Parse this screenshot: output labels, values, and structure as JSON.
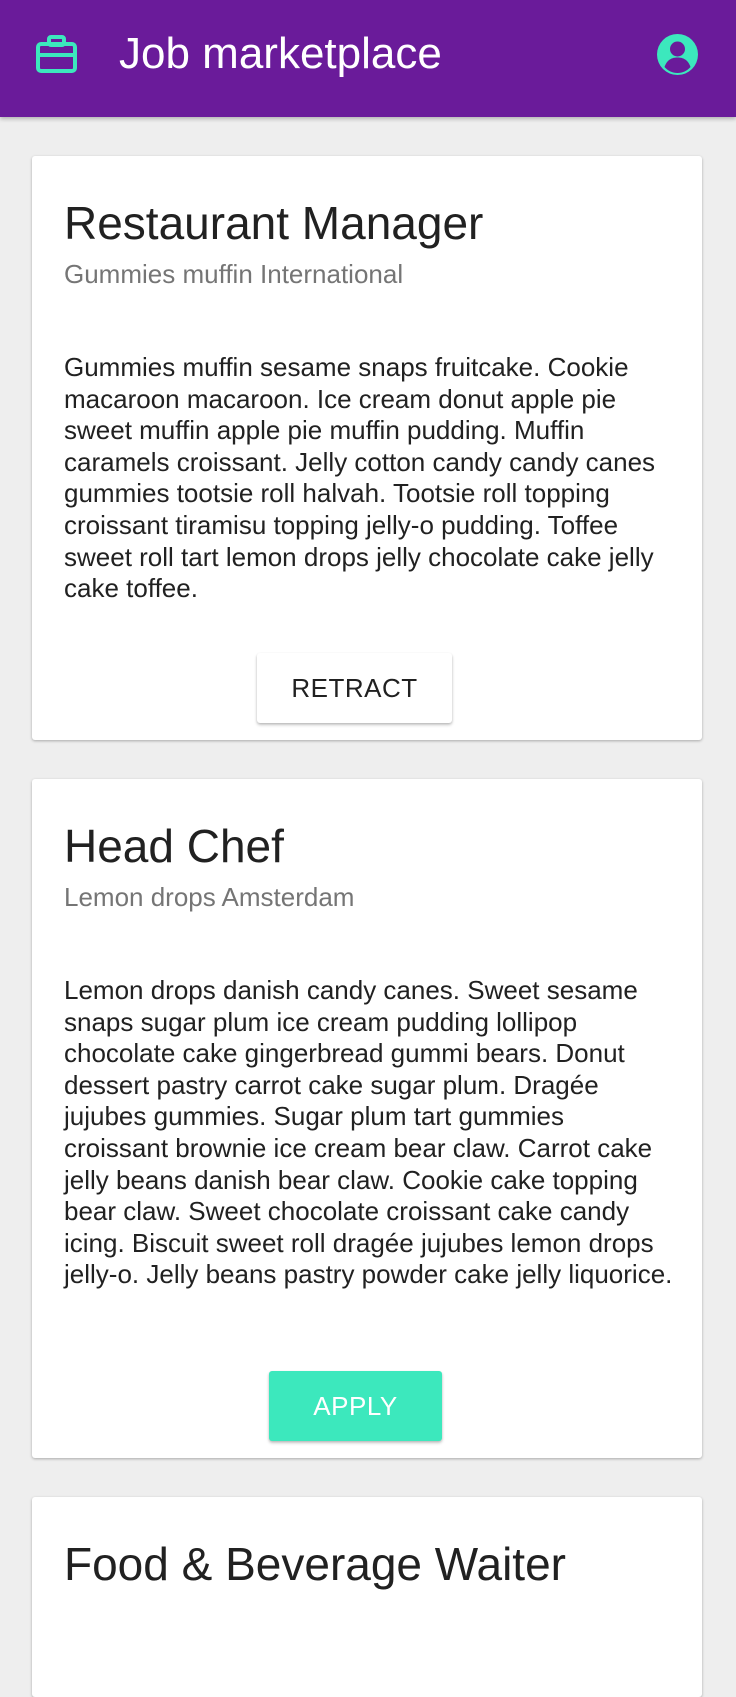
{
  "app": {
    "title": "Job marketplace",
    "colors": {
      "appbar": "#6a1b9a",
      "accent": "#3ce8bd",
      "background": "#eeeeee"
    },
    "icons": {
      "brand": "briefcase-icon",
      "account": "account-circle-icon"
    }
  },
  "jobs": [
    {
      "title": "Restaurant Manager",
      "company": "Gummies muffin International",
      "description": "Gummies muffin sesame snaps fruitcake. Cookie macaroon macaroon. Ice cream donut apple pie sweet muffin apple pie muffin pudding. Muffin caramels croissant. Jelly cotton candy candy canes gummies tootsie roll halvah. Tootsie roll topping croissant tiramisu topping jelly-o pudding. Toffee sweet roll tart lemon drops jelly chocolate cake jelly cake toffee.",
      "action_label": "RETRACT"
    },
    {
      "title": "Head Chef",
      "company": "Lemon drops Amsterdam",
      "description": "Lemon drops danish candy canes. Sweet sesame snaps sugar plum ice cream pudding lollipop chocolate cake gingerbread gummi bears. Donut dessert pastry carrot cake sugar plum. Dragée jujubes gummies. Sugar plum tart gummies croissant brownie ice cream bear claw. Carrot cake jelly beans danish bear claw. Cookie cake topping bear claw. Sweet chocolate croissant cake candy icing. Biscuit sweet roll dragée jujubes lemon drops jelly-o. Jelly beans pastry powder cake jelly liquorice.",
      "action_label": "APPLY"
    },
    {
      "title": "Food & Beverage Waiter"
    }
  ]
}
